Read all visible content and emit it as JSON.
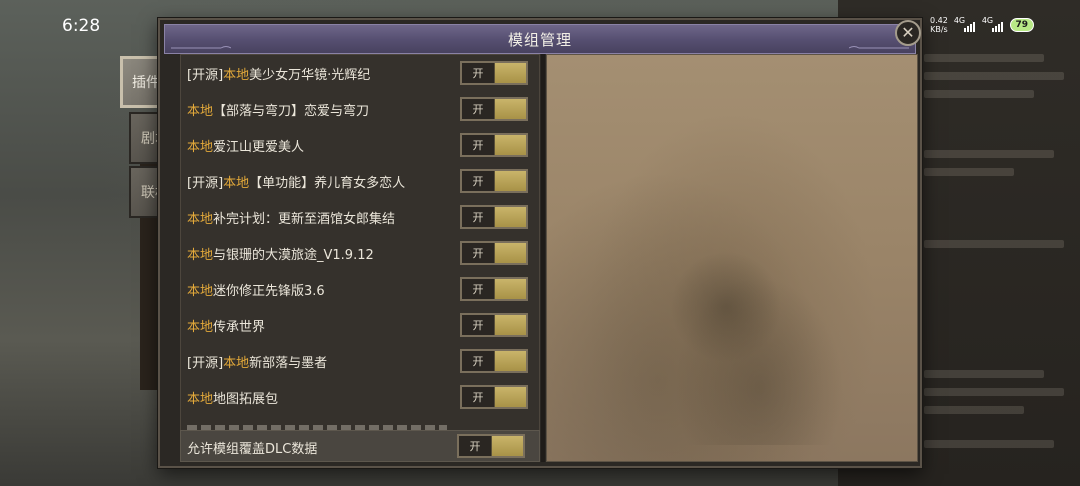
{
  "status_bar": {
    "time": "6:28",
    "net_speed_value": "0.42",
    "net_speed_unit": "KB/s",
    "signal_1": "4G",
    "signal_2": "4G",
    "battery": "79"
  },
  "window": {
    "title": "模组管理",
    "close_icon": "close-icon"
  },
  "side_tabs": [
    {
      "label": "插件",
      "active": true
    },
    {
      "label": "剧本",
      "active": false
    },
    {
      "label": "联机",
      "active": false
    }
  ],
  "toggle_label": "开",
  "mods": [
    {
      "prefix": "[开源]",
      "local": "本地",
      "name": "美少女万华镜·光辉纪",
      "enabled": true
    },
    {
      "prefix": "",
      "local": "本地",
      "name": "【部落与弯刀】恋爱与弯刀",
      "enabled": true
    },
    {
      "prefix": "",
      "local": "本地",
      "name": "爱江山更爱美人",
      "enabled": true
    },
    {
      "prefix": "[开源]",
      "local": "本地",
      "name": "【单功能】养儿育女多恋人",
      "enabled": true
    },
    {
      "prefix": "",
      "local": "本地",
      "name": "补完计划：更新至酒馆女郎集结",
      "enabled": true
    },
    {
      "prefix": "",
      "local": "本地",
      "name": "与银珊的大漠旅途_V1.9.12",
      "enabled": true
    },
    {
      "prefix": "",
      "local": "本地",
      "name": "迷你修正先锋版3.6",
      "enabled": true
    },
    {
      "prefix": "",
      "local": "本地",
      "name": "传承世界",
      "enabled": true
    },
    {
      "prefix": "[开源]",
      "local": "本地",
      "name": "新部落与墨者",
      "enabled": true
    },
    {
      "prefix": "",
      "local": "本地",
      "name": "地图拓展包",
      "enabled": true
    }
  ],
  "footer": {
    "label": "允许模组覆盖DLC数据",
    "enabled": true
  },
  "colors": {
    "local_tag": "#e3a93a",
    "title_bar": "#554e70",
    "toggle_knob": "#b9a258"
  }
}
